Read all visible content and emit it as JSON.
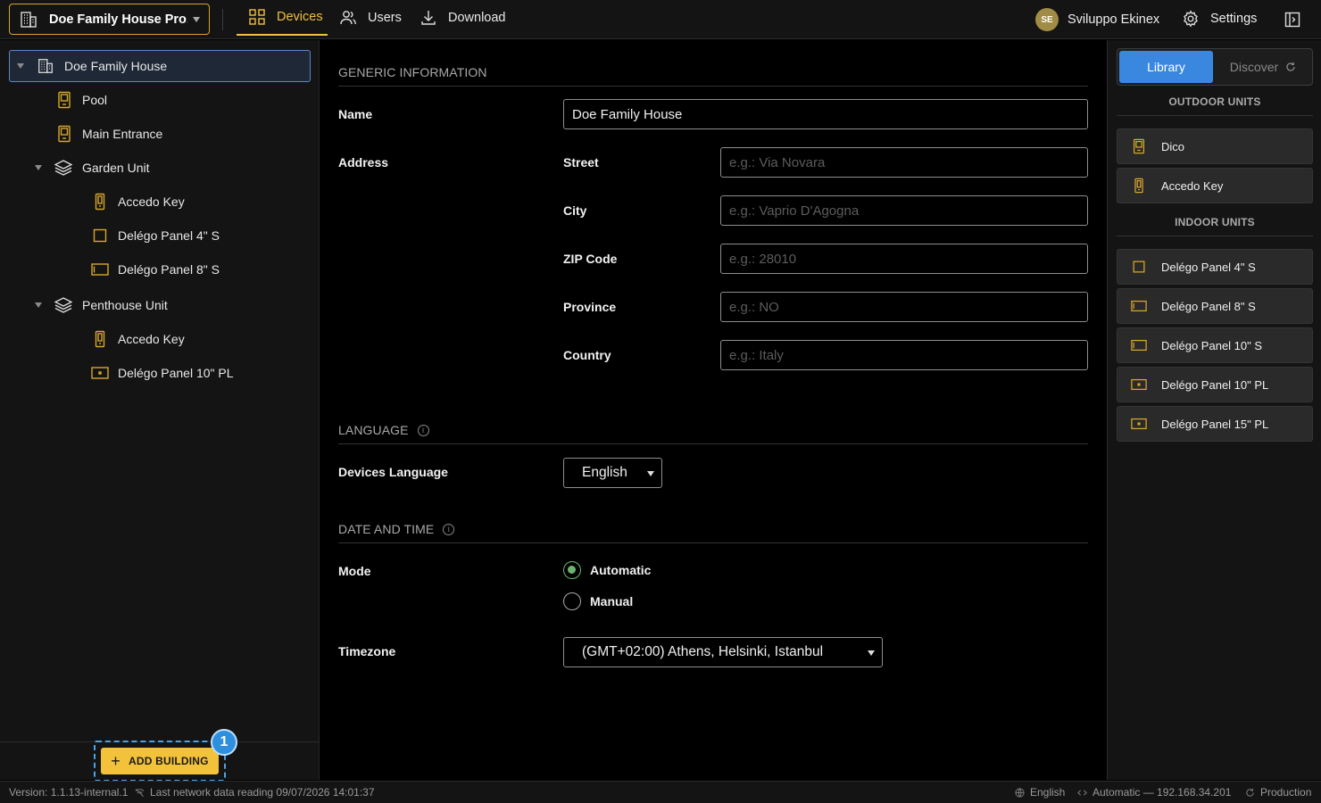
{
  "topbar": {
    "project_name": "Doe Family House Pro...",
    "tabs": [
      {
        "label": "Devices",
        "active": true
      },
      {
        "label": "Users",
        "active": false
      },
      {
        "label": "Download",
        "active": false
      }
    ],
    "user_initials": "SE",
    "user_name": "Sviluppo Ekinex",
    "settings_label": "Settings"
  },
  "tree": {
    "root": "Doe Family House",
    "items": [
      {
        "label": "Pool",
        "icon": "outdoor-panel-icon"
      },
      {
        "label": "Main Entrance",
        "icon": "outdoor-panel-icon"
      },
      {
        "label": "Garden Unit",
        "icon": "layers-icon"
      },
      {
        "label": "Accedo Key",
        "icon": "keypad-icon"
      },
      {
        "label": "Delégo Panel 4\" S",
        "icon": "panel-square-icon"
      },
      {
        "label": "Delégo Panel 8\" S",
        "icon": "panel-wide-icon"
      },
      {
        "label": "Penthouse Unit",
        "icon": "layers-icon"
      },
      {
        "label": "Accedo Key",
        "icon": "keypad-icon"
      },
      {
        "label": "Delégo Panel 10\" PL",
        "icon": "panel-pl-icon"
      }
    ],
    "add_building_label": "ADD BUILDING",
    "step_badge": "1"
  },
  "form": {
    "generic_title": "GENERIC INFORMATION",
    "name_label": "Name",
    "name_value": "Doe Family House",
    "address_label": "Address",
    "street_label": "Street",
    "street_placeholder": "e.g.: Via Novara",
    "city_label": "City",
    "city_placeholder": "e.g.: Vaprio D'Agogna",
    "zip_label": "ZIP Code",
    "zip_placeholder": "e.g.: 28010",
    "province_label": "Province",
    "province_placeholder": "e.g.: NO",
    "country_label": "Country",
    "country_placeholder": "e.g.: Italy",
    "language_title": "LANGUAGE",
    "devices_language_label": "Devices Language",
    "devices_language_value": "English",
    "datetime_title": "DATE AND TIME",
    "mode_label": "Mode",
    "mode_automatic": "Automatic",
    "mode_manual": "Manual",
    "mode_selected": "Automatic",
    "timezone_label": "Timezone",
    "timezone_value": "(GMT+02:00) Athens, Helsinki, Istanbul"
  },
  "library": {
    "tab_library": "Library",
    "tab_discover": "Discover",
    "outdoor_title": "OUTDOOR UNITS",
    "outdoor_items": [
      {
        "label": "Dico",
        "icon": "outdoor-panel-icon"
      },
      {
        "label": "Accedo Key",
        "icon": "keypad-icon"
      }
    ],
    "indoor_title": "INDOOR UNITS",
    "indoor_items": [
      {
        "label": "Delégo Panel 4\" S",
        "icon": "panel-square-icon"
      },
      {
        "label": "Delégo Panel 8\" S",
        "icon": "panel-wide-icon"
      },
      {
        "label": "Delégo Panel 10\" S",
        "icon": "panel-wide-icon"
      },
      {
        "label": "Delégo Panel 10\" PL",
        "icon": "panel-pl-icon"
      },
      {
        "label": "Delégo Panel 15\" PL",
        "icon": "panel-pl-icon"
      }
    ]
  },
  "status": {
    "version": "Version: 1.1.13-internal.1",
    "last_reading": "Last network data reading 09/07/2026 14:01:37",
    "language": "English",
    "network": "Automatic — 192.168.34.201",
    "environment": "Production"
  },
  "colors": {
    "accent": "#f0c040",
    "primary_blue": "#3a87e0",
    "device_icon": "#d8a72a",
    "radio_on": "#6db56f"
  }
}
